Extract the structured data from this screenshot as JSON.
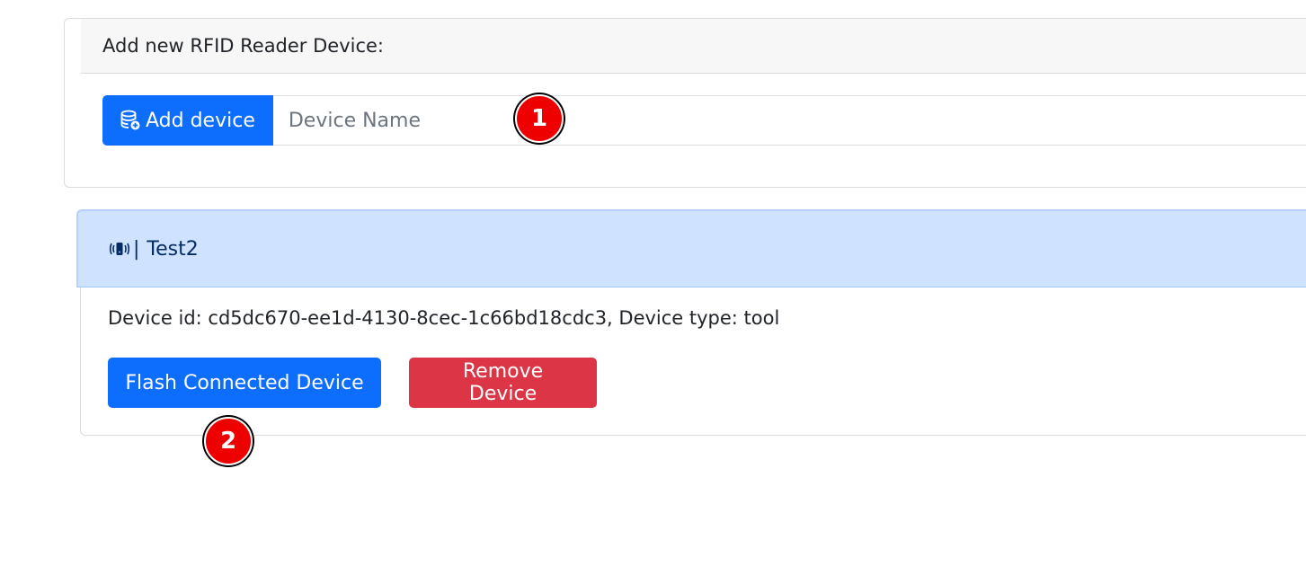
{
  "add_device_card": {
    "header": "Add new RFID Reader Device:",
    "add_button_label": "Add device",
    "add_button_icon": "database-add-icon",
    "device_name_input": {
      "value": "",
      "placeholder": "Device Name"
    }
  },
  "device_card": {
    "icon": "rfid-reader-icon",
    "separator": "|",
    "name": "Test2",
    "info": "Device id: cd5dc670-ee1d-4130-8cec-1c66bd18cdc3, Device type: tool",
    "flash_button_label": "Flash Connected Device",
    "remove_button_label": "Remove Device"
  },
  "step_markers": [
    "1",
    "2"
  ],
  "colors": {
    "primary": "#0d6efd",
    "danger": "#dc3545",
    "header_info_bg": "#cfe2ff",
    "marker_red": "#ee0000"
  }
}
